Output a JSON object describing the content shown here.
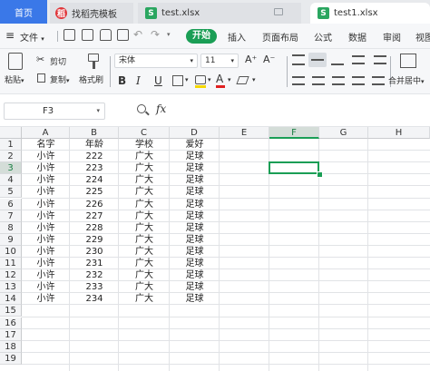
{
  "tabs": [
    {
      "label": "首页",
      "active": false
    },
    {
      "label": "找稻壳模板",
      "active": false
    },
    {
      "label": "test.xlsx",
      "active": false
    },
    {
      "label": "test1.xlsx",
      "active": true
    }
  ],
  "menu": {
    "file": "文件",
    "items": [
      "开始",
      "插入",
      "页面布局",
      "公式",
      "数据",
      "审阅",
      "视图"
    ],
    "active": "开始"
  },
  "toolbar": {
    "paste": "粘贴",
    "cut": "剪切",
    "copy": "复制",
    "format_painter": "格式刷",
    "font_name": "宋体",
    "font_size": "11",
    "bold": "B",
    "italic": "I",
    "underline": "U",
    "font_color_glyph": "A",
    "merge_center": "合并居中"
  },
  "formula_bar": {
    "name_box": "F3",
    "fx": "fx",
    "formula": ""
  },
  "grid": {
    "columns": [
      "A",
      "B",
      "C",
      "D",
      "E",
      "F",
      "G",
      "H"
    ],
    "selected_column": "F",
    "selected_row": 3,
    "selected_cell": "F3",
    "row_numbers": [
      "1",
      "2",
      "3",
      "4",
      "5",
      "6",
      "7",
      "8",
      "9",
      "10",
      "11",
      "12",
      "13",
      "14",
      "15",
      "16",
      "17",
      "18",
      "19"
    ],
    "header_row": [
      "名字",
      "年龄",
      "学校",
      "爱好"
    ],
    "rows": [
      [
        "小许",
        "222",
        "广大",
        "足球"
      ],
      [
        "小许",
        "223",
        "广大",
        "足球"
      ],
      [
        "小许",
        "224",
        "广大",
        "足球"
      ],
      [
        "小许",
        "225",
        "广大",
        "足球"
      ],
      [
        "小许",
        "226",
        "广大",
        "足球"
      ],
      [
        "小许",
        "227",
        "广大",
        "足球"
      ],
      [
        "小许",
        "228",
        "广大",
        "足球"
      ],
      [
        "小许",
        "229",
        "广大",
        "足球"
      ],
      [
        "小许",
        "230",
        "广大",
        "足球"
      ],
      [
        "小许",
        "231",
        "广大",
        "足球"
      ],
      [
        "小许",
        "232",
        "广大",
        "足球"
      ],
      [
        "小许",
        "233",
        "广大",
        "足球"
      ],
      [
        "小许",
        "234",
        "广大",
        "足球"
      ]
    ]
  },
  "colors": {
    "accent_green": "#1a9e55",
    "home_tab_blue": "#3a78e8",
    "sheet_icon_green": "#2aa660",
    "docer_red": "#e0373b"
  }
}
